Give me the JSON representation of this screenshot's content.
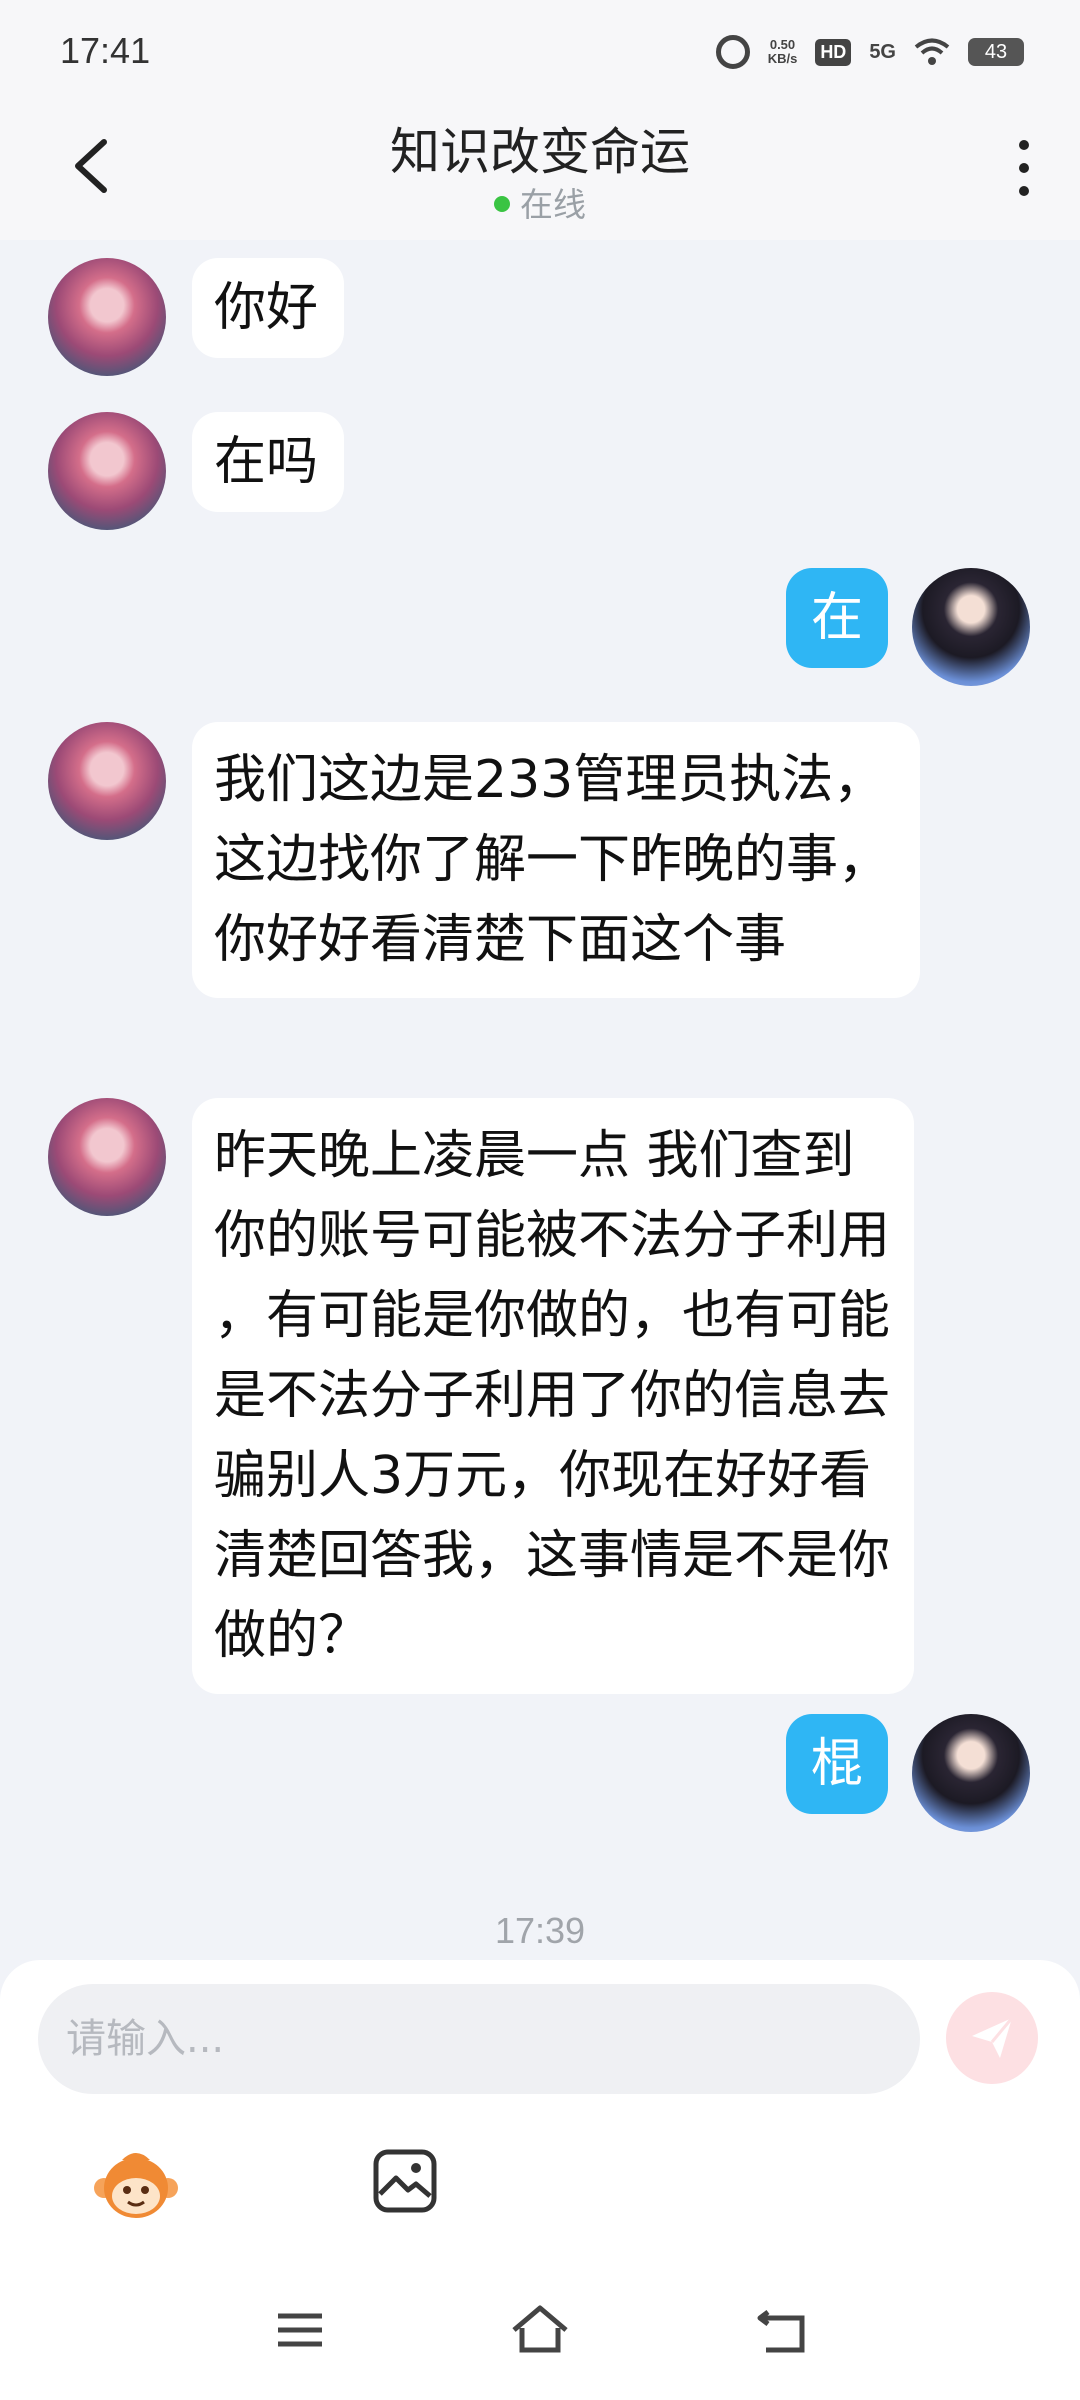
{
  "status_bar": {
    "time": "17:41",
    "speed_value": "0.50",
    "speed_unit": "KB/s",
    "hd": "HD",
    "network": "5G",
    "battery": "43"
  },
  "header": {
    "title": "知识改变命运",
    "status": "在线",
    "status_color": "#3ac443"
  },
  "messages": [
    {
      "side": "left",
      "text": "你好"
    },
    {
      "side": "left",
      "text": "在吗"
    },
    {
      "side": "right",
      "text": "在"
    },
    {
      "side": "left",
      "text": "我们这边是233管理员执法，这边找你了解一下昨晚的事，你好好看清楚下面这个事"
    },
    {
      "side": "left",
      "text": "昨天晚上凌晨一点 我们查到你的账号可能被不法分子利用 ，有可能是你做的，也有可能是不法分子利用了你的信息去骗别人3万元，你现在好好看清楚回答我，这事情是不是你做的？"
    },
    {
      "side": "right",
      "text": "棍"
    }
  ],
  "timestamp": "17:39",
  "composer": {
    "placeholder": "请输入...",
    "send_icon": "paper-plane-icon",
    "emoji_icon": "monkey-emoji-icon",
    "image_icon": "image-icon"
  },
  "colors": {
    "my_bubble": "#2fb6f4",
    "their_bubble": "#ffffff",
    "background": "#f1f3f8",
    "send_button": "#fde0e3"
  }
}
